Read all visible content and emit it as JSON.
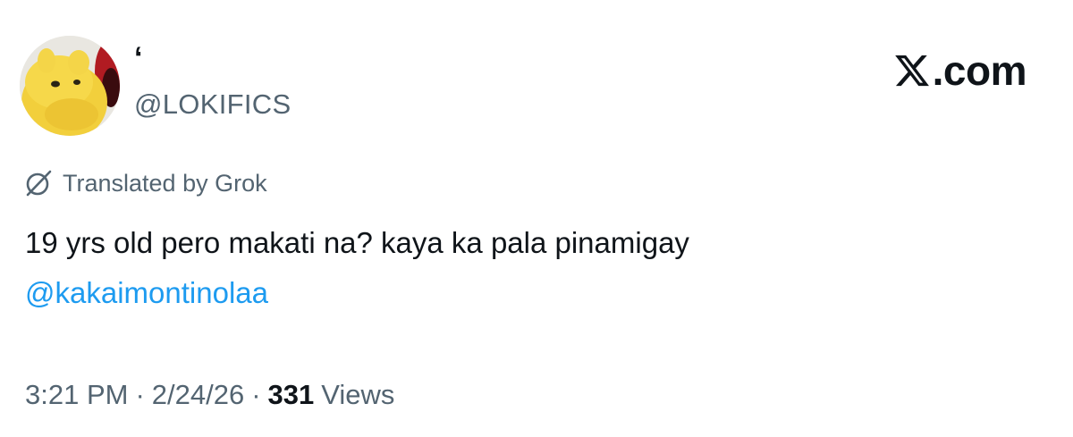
{
  "author": {
    "display_name": "‘",
    "handle": "@LOKIFICS",
    "avatar_icon": "yellow-creature-avatar"
  },
  "brand": {
    "logo_icon": "x-logo-icon",
    "text": ".com"
  },
  "translation": {
    "icon": "grok-icon",
    "label": "Translated by Grok"
  },
  "tweet": {
    "text": "19 yrs old pero makati na? kaya ka pala pinamigay",
    "mention": "@kakaimontinolaa"
  },
  "meta": {
    "time": "3:21 PM",
    "separator": "·",
    "date": "2/24/26",
    "views_count": "331",
    "views_label": "Views"
  },
  "colors": {
    "text_primary": "#0f1419",
    "text_secondary": "#536471",
    "link": "#1d9bf0"
  }
}
